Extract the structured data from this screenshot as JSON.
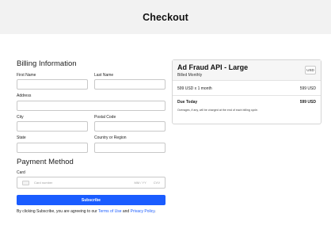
{
  "header": {
    "title": "Checkout"
  },
  "billing": {
    "title": "Billing Information",
    "first_name_label": "First Name",
    "last_name_label": "Last Name",
    "address_label": "Address",
    "city_label": "City",
    "postal_code_label": "Postal Code",
    "state_label": "State",
    "country_label": "Country or Region"
  },
  "payment": {
    "title": "Payment Method",
    "card_label": "Card",
    "card_number_placeholder": "Card number",
    "expiry_placeholder": "MM / YY",
    "cvv_placeholder": "CVV",
    "subscribe_label": "Subscribe",
    "terms_prefix": "By clicking Subscribe, you are agreeing to our ",
    "terms_link": "Terms of Use",
    "terms_and": " and ",
    "privacy_link": "Privacy Policy",
    "terms_suffix": "."
  },
  "summary": {
    "plan_name": "Ad Fraud API - Large",
    "billing_cycle": "Billed Monthly",
    "currency": "USD",
    "line_item": "599 USD x 1 month",
    "line_amount": "599 USD",
    "due_label": "Due Today",
    "due_amount": "599 USD",
    "note": "Overages, if any, will be charged at the end of each billing cycle."
  },
  "colors": {
    "accent": "#1a5cff",
    "header_bg": "#f2f2f2"
  },
  "icons": {
    "card": "credit-card-icon"
  }
}
